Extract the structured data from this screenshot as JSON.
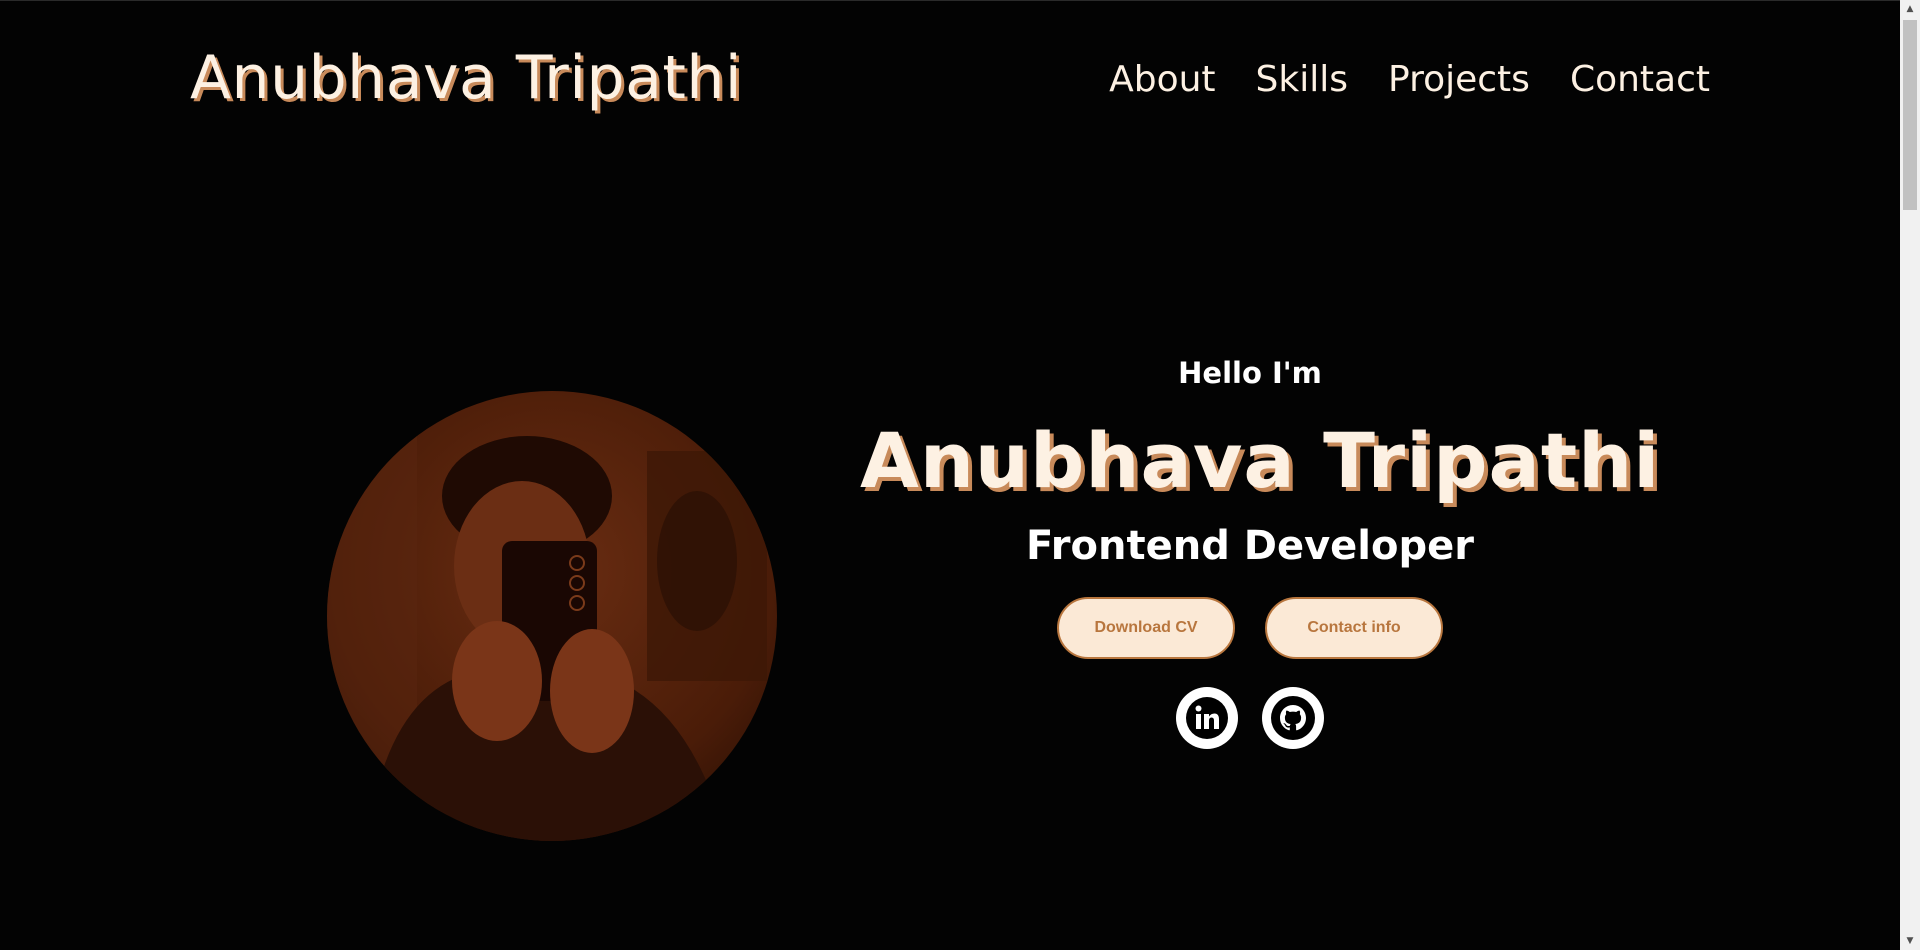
{
  "header": {
    "logo": "Anubhava Tripathi",
    "nav": [
      "About",
      "Skills",
      "Projects",
      "Contact"
    ]
  },
  "hero": {
    "greeting": "Hello I'm",
    "name": "Anubhava Tripathi",
    "role": "Frontend Developer",
    "buttons": {
      "download_cv": "Download CV",
      "contact_info": "Contact info"
    },
    "socials": [
      "linkedin-icon",
      "github-icon"
    ]
  },
  "colors": {
    "background": "#030303",
    "accent_text": "#fdf1e3",
    "shadow": "#c88a5a",
    "button_bg": "#fbe9d6",
    "button_text": "#b8763e"
  }
}
